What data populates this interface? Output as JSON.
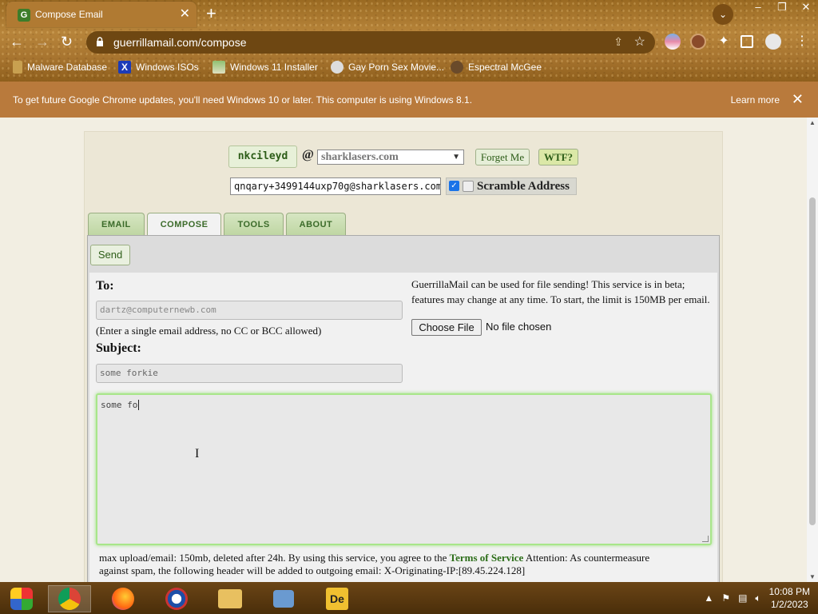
{
  "browser": {
    "tab_title": "Compose Email",
    "tab_favicon_letter": "G",
    "url": "guerrillamail.com/compose",
    "bookmarks": [
      {
        "label": "Malware Database",
        "icon": "malware-icon"
      },
      {
        "label": "Windows ISOs",
        "icon": "x-icon"
      },
      {
        "label": "Windows 11 Installer",
        "icon": "image-icon"
      },
      {
        "label": "Gay Porn Sex Movie...",
        "icon": "site-icon"
      },
      {
        "label": "Espectral McGee",
        "icon": "avatar-icon"
      }
    ]
  },
  "infobar": {
    "message": "To get future Google Chrome updates, you'll need Windows 10 or later. This computer is using Windows 8.1.",
    "learn_more": "Learn more"
  },
  "mailbox": {
    "username": "nkcileyd",
    "at": "@",
    "domain": "sharklasers.com",
    "forget_label": "Forget Me",
    "wtf_label": "WTF?",
    "scrambled_address": "qnqary+3499144uxp70g@sharklasers.com",
    "scramble_checked": true,
    "scramble_label": "Scramble Address"
  },
  "tabs": [
    {
      "label": "EMAIL",
      "active": false
    },
    {
      "label": "COMPOSE",
      "active": true
    },
    {
      "label": "TOOLS",
      "active": false
    },
    {
      "label": "ABOUT",
      "active": false
    }
  ],
  "compose": {
    "send_label": "Send",
    "to_label": "To:",
    "to_value": "dartz@computernewb.com",
    "to_hint": "(Enter a single email address, no CC or BCC allowed)",
    "subject_label": "Subject:",
    "subject_value": "some forkie",
    "body_value": "some fo",
    "file_note": "GuerrillaMail can be used for file sending! This service is in beta; features may change at any time. To start, the limit is 150MB per email.",
    "choose_file_label": "Choose File",
    "no_file_label": "No file chosen",
    "footer_pre": "max upload/email: 150mb, deleted after 24h. By using this service, you agree to the ",
    "footer_tos": "Terms of Service",
    "footer_post": " Attention: As countermeasure against spam, the following header will be added to outgoing email: X-Originating-IP:[89.45.224.128]"
  },
  "taskbar": {
    "time": "10:08 PM",
    "date": "1/2/2023"
  },
  "colors": {
    "accent_green": "#2d5d18",
    "chrome_theme": "#a87530",
    "focus_glow": "#9be07a"
  }
}
